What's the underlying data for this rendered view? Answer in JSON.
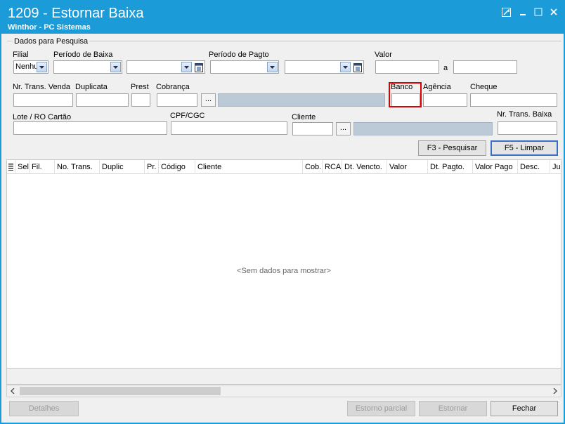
{
  "window": {
    "title": "1209 - Estornar Baixa",
    "subtitle": "Winthor - PC Sistemas"
  },
  "filters": {
    "group_title": "Dados para Pesquisa",
    "filial_label": "Filial",
    "filial_value": "Nenhu",
    "periodo_baixa_label": "Período de Baixa",
    "periodo_pagto_label": "Período de Pagto",
    "valor_label": "Valor",
    "valor_sep": "a",
    "nr_trans_venda_label": "Nr. Trans. Venda",
    "duplicata_label": "Duplicata",
    "prest_label": "Prest",
    "cobranca_label": "Cobrança",
    "banco_label": "Banco",
    "agencia_label": "Agência",
    "cheque_label": "Cheque",
    "lote_label": "Lote / RO Cartão",
    "cpf_label": "CPF/CGC",
    "cliente_label": "Cliente",
    "nr_trans_baixa_label": "Nr. Trans. Baixa",
    "ellipsis": "..."
  },
  "actions": {
    "pesquisar": "F3 - Pesquisar",
    "limpar": "F5 - Limpar"
  },
  "grid": {
    "columns": [
      "Sel",
      "Fil.",
      "No. Trans.",
      "Duplic",
      "Pr.",
      "Código",
      "Cliente",
      "Cob.",
      "RCA",
      "Dt. Vencto.",
      "Valor",
      "Dt. Pagto.",
      "Valor Pago",
      "Desc.",
      "Jur"
    ],
    "empty_message": "<Sem dados para mostrar>"
  },
  "footer": {
    "detalhes": "Detalhes",
    "estorno_parcial": "Estorno parcial",
    "estornar": "Estornar",
    "fechar": "Fechar"
  },
  "colors": {
    "titlebar": "#1b9bd8",
    "highlight": "#e00000"
  }
}
